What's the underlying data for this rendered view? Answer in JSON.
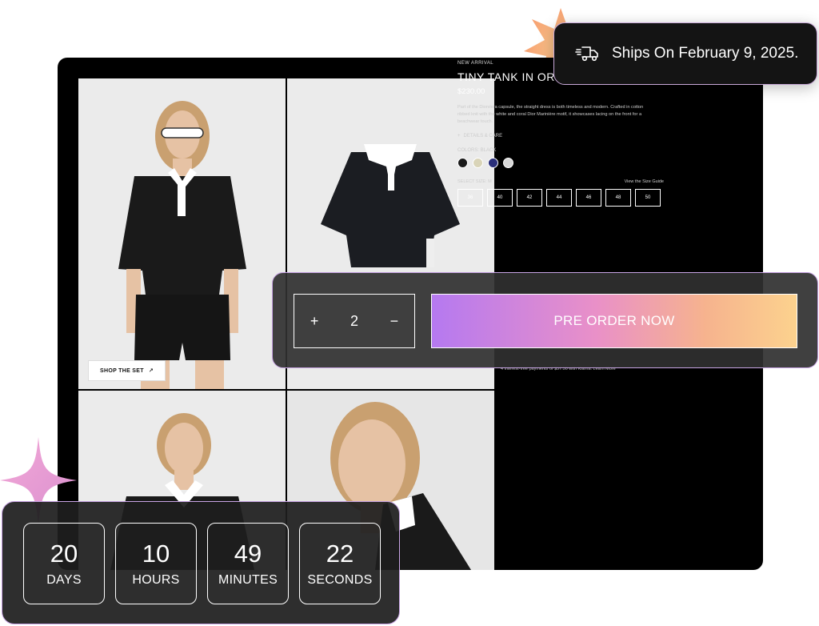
{
  "product": {
    "eyebrow": "NEW ARRIVAL",
    "title": "TINY TANK IN ORGANIC COTTON",
    "price": "$230.00",
    "description": "Part of the Diorviera capsule, the straight dress is both timeless and modern. Crafted in cotton ribbed knit with the white and coral Dior Marinière motif, it showcases lacing on the front for a beachwear touch.",
    "details_label": "DETAILS & CARE",
    "colors_label": "COLORS: BLACK",
    "swatches": [
      "#1a1a1a",
      "#d9d4b8",
      "#2a2f7a",
      "#d8d8d8"
    ],
    "size_label": "SELECT SIZE: M",
    "size_guide": "View the Size Guide",
    "sizes": [
      "36",
      "40",
      "42",
      "44",
      "46",
      "48",
      "50"
    ],
    "klarna": "4 interest-free payments of $57.50 with Klarna. Learn More"
  },
  "gallery": {
    "shop_set": "SHOP THE SET"
  },
  "shipping": {
    "text": "Ships On February 9, 2025."
  },
  "order": {
    "plus": "+",
    "quantity": "2",
    "minus": "−",
    "cta": "PRE ORDER NOW"
  },
  "countdown": [
    {
      "value": "20",
      "label": "DAYS"
    },
    {
      "value": "10",
      "label": "HOURS"
    },
    {
      "value": "49",
      "label": "MINUTES"
    },
    {
      "value": "22",
      "label": "SECONDS"
    }
  ]
}
